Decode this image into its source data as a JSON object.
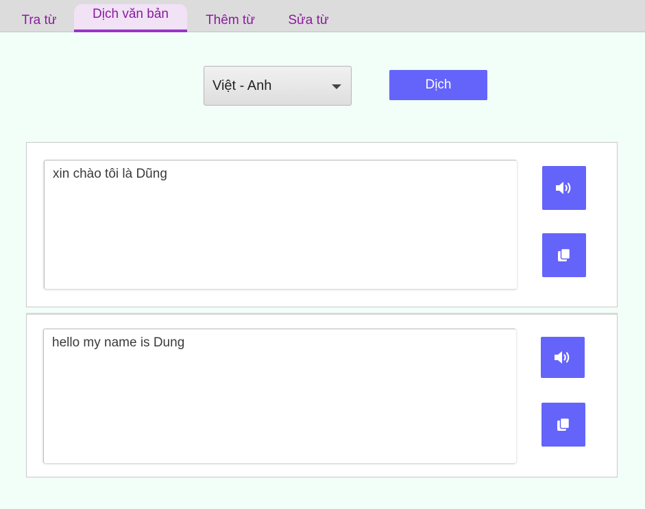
{
  "tabs": [
    {
      "label": "Tra từ"
    },
    {
      "label": "Dịch văn bản",
      "active": true
    },
    {
      "label": "Thêm từ"
    },
    {
      "label": "Sửa từ"
    }
  ],
  "controls": {
    "language_pair": "Việt - Anh",
    "translate_label": "Dịch"
  },
  "source": {
    "text": "xin chào tôi là Dũng",
    "speak_icon": "speaker-icon",
    "copy_icon": "copy-icon"
  },
  "target": {
    "text": "hello my name is Dung",
    "speak_icon": "speaker-icon",
    "copy_icon": "copy-icon"
  },
  "colors": {
    "accent": "#6464fa",
    "tab_text": "#8a1a9e",
    "active_tab_underline": "#9b32c7",
    "background": "#f2fff9"
  }
}
